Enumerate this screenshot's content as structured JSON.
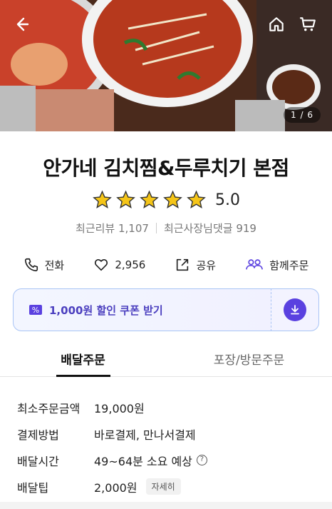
{
  "hero": {
    "page_indicator": "1 / 6",
    "icons": [
      "back-arrow-icon",
      "home-icon",
      "cart-icon"
    ]
  },
  "store": {
    "name": "안가네 김치찜&두루치기 본점",
    "rating": "5.0",
    "stars": 5,
    "recent_reviews": "최근리뷰 1,107",
    "owner_replies": "최근사장님댓글 919"
  },
  "actions": {
    "call": "전화",
    "likes": "2,956",
    "share": "공유",
    "group_order": "함께주문"
  },
  "coupon": {
    "label": "1,000원 할인 쿠폰 받기"
  },
  "tabs": [
    "배달주문",
    "포장/방문주문"
  ],
  "info": {
    "min_order_label": "최소주문금액",
    "min_order_value": "19,000원",
    "payment_label": "결제방법",
    "payment_value": "바로결제, 만나서결제",
    "delivery_time_label": "배달시간",
    "delivery_time_value": "49~64분 소요 예상",
    "tip_label": "배달팁",
    "tip_value": "2,000원",
    "tip_detail": "자세히"
  },
  "colors": {
    "accent": "#5a41e0",
    "coupon_text": "#4b3fbf",
    "star": "#f5c518"
  }
}
